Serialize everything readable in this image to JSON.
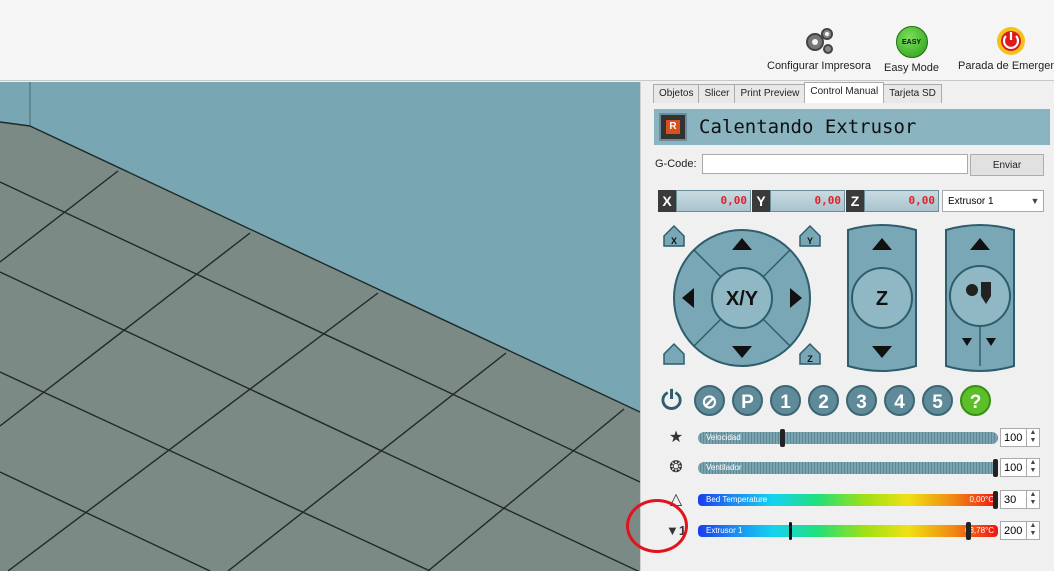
{
  "toolbar": {
    "configure_label": "Configurar Impresora",
    "easy_mode_label": "Easy Mode",
    "easy_badge": "EASY",
    "emergency_label": "Parada de Emergenci"
  },
  "tabs": [
    "Objetos",
    "Slicer",
    "Print Preview",
    "Control Manual",
    "Tarjeta SD"
  ],
  "active_tab": "Control Manual",
  "status": {
    "text": "Calentando Extrusor",
    "icon_letter": "R"
  },
  "gcode": {
    "label": "G-Code:",
    "value": "",
    "send_label": "Enviar"
  },
  "coords": {
    "x_label": "X",
    "x_value": "0,00",
    "y_label": "Y",
    "y_value": "0,00",
    "z_label": "Z",
    "z_value": "0,00"
  },
  "extruder_select": {
    "selected": "Extrusor 1"
  },
  "jog": {
    "xy_label": "X/Y",
    "z_label": "Z",
    "home_x": "X",
    "home_y": "Y",
    "home_z": "Z"
  },
  "actions": [
    "1",
    "2",
    "3",
    "4",
    "5"
  ],
  "action_p": "P",
  "help_label": "?",
  "sliders": {
    "speed": {
      "label": "Velocidad",
      "value": "100",
      "fraction": 0.28
    },
    "fan": {
      "label": "Ventilador",
      "value": "100",
      "fraction": 1.0
    },
    "bed": {
      "label": "Bed Temperature",
      "reading": "0,00°C",
      "value": "30",
      "fraction": 1.0
    },
    "extruder": {
      "label": "Extrusor 1",
      "reading": "63,78°C",
      "value": "200",
      "fraction": 0.9,
      "current_fraction": 0.31
    }
  },
  "extruder_icon_label": "1",
  "colors": {
    "viewport_bg": "#79a6b3",
    "floor": "#7b8a84",
    "grid_line": "#1e2a2a",
    "jog_fill": "#7aa7b5",
    "jog_stroke": "#2e5d6c",
    "highlight_ring": "#e0141e"
  }
}
